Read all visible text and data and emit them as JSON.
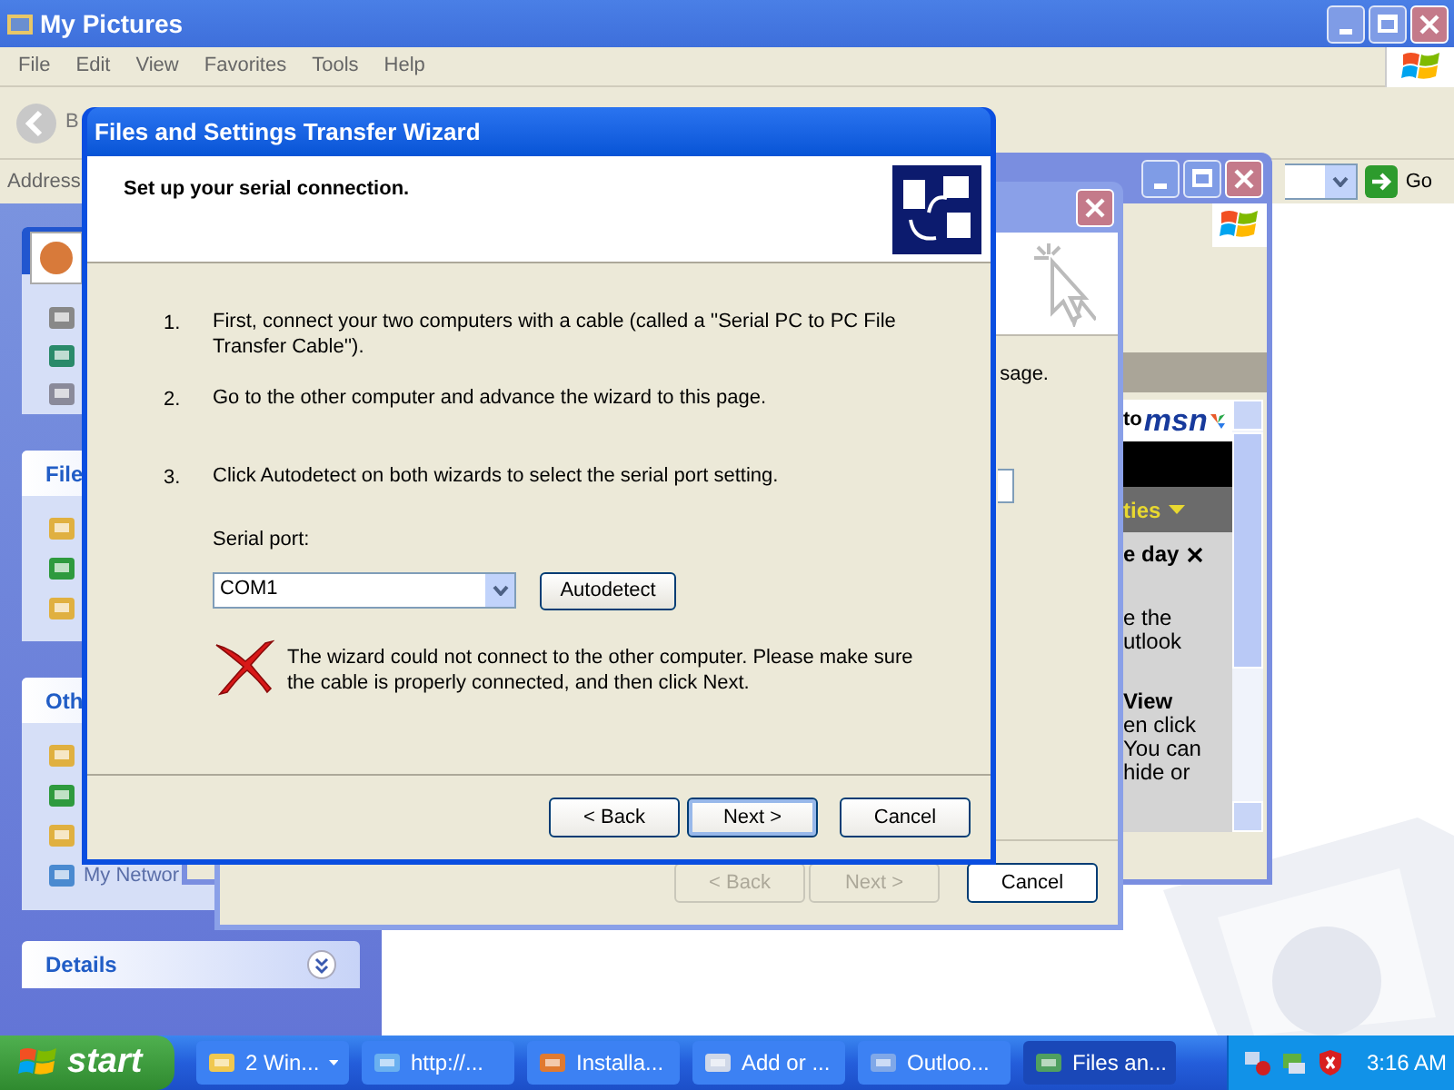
{
  "explorer": {
    "title": "My Pictures",
    "menu": [
      "File",
      "Edit",
      "View",
      "Favorites",
      "Tools",
      "Help"
    ],
    "back_label": "B",
    "address_label": "Address",
    "go_label": "Go",
    "task_panes": [
      {
        "kind": "picture_header"
      },
      {
        "kind": "titled",
        "title": "File"
      },
      {
        "kind": "titled",
        "title": "Oth",
        "item_label": "My Networ"
      },
      {
        "kind": "collapsed",
        "title": "Details"
      }
    ]
  },
  "outlook_window": {
    "msn_logo": [
      "to",
      "msn"
    ],
    "menu_text": "ties",
    "lines": [
      {
        "text": "e day",
        "kind": "heading"
      },
      {
        "text": "e the",
        "kind": "body"
      },
      {
        "text": "utlook",
        "kind": "body"
      },
      {
        "text": "View",
        "kind": "heading"
      },
      {
        "text": "en click",
        "kind": "body"
      },
      {
        "text": "You can",
        "kind": "body"
      },
      {
        "text": "hide or",
        "kind": "body"
      }
    ]
  },
  "other_wizard": {
    "body_text": "sage.",
    "buttons": [
      {
        "label": "< Back",
        "disabled": true
      },
      {
        "label": "Next >",
        "disabled": true
      },
      {
        "label": "Cancel",
        "disabled": false
      }
    ]
  },
  "wizard": {
    "title": "Files and Settings Transfer Wizard",
    "heading": "Set up your serial connection.",
    "steps": [
      {
        "number": "1.",
        "text": "First, connect your two computers with a cable (called a ''Serial PC to PC File Transfer Cable'')."
      },
      {
        "number": "2.",
        "text": "Go to the other computer and advance the wizard to this page."
      },
      {
        "number": "3.",
        "text": "Click Autodetect on both wizards to select the serial port setting."
      }
    ],
    "serial_port_label": "Serial port:",
    "serial_port_value": "COM1",
    "autodetect_label": "Autodetect",
    "error": "The wizard could not connect to the other computer. Please make sure the cable is properly connected, and then click Next.",
    "buttons": [
      {
        "label": "< Back",
        "default": false
      },
      {
        "label": "Next >",
        "default": true
      },
      {
        "label": "Cancel",
        "default": false
      }
    ]
  },
  "taskbar": {
    "start": "start",
    "tasks": [
      {
        "label": "2 Win...",
        "selected": false,
        "kind": "group"
      },
      {
        "label": "http://...",
        "selected": false,
        "kind": "single"
      },
      {
        "label": "Installa...",
        "selected": false,
        "kind": "single"
      },
      {
        "label": "Add or ...",
        "selected": false,
        "kind": "single"
      },
      {
        "label": "Outloo...",
        "selected": false,
        "kind": "single"
      },
      {
        "label": "Files an...",
        "selected": true,
        "kind": "single"
      }
    ],
    "clock": "3:16 AM"
  }
}
